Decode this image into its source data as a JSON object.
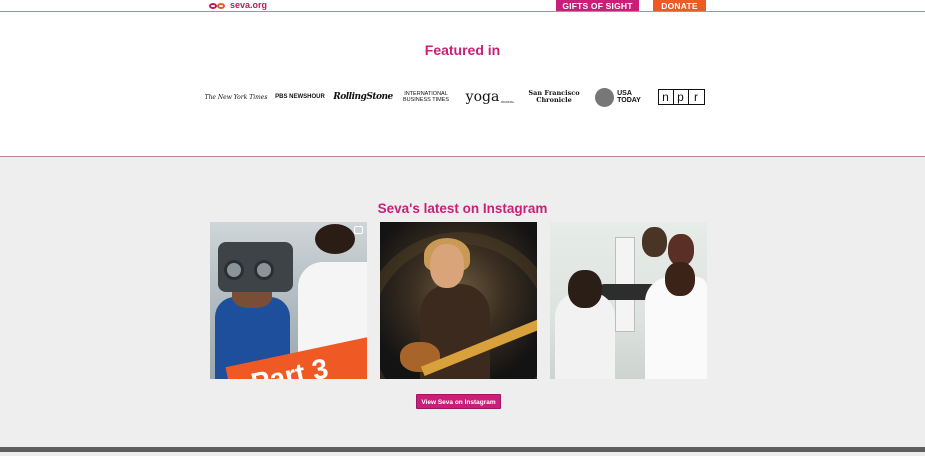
{
  "header": {
    "logo_text": "seva.org",
    "gifts_label": "GIFTS OF SIGHT",
    "donate_label": "DONATE"
  },
  "featured": {
    "title": "Featured in",
    "logos": [
      {
        "name": "The New York Times",
        "text": "The New York Times"
      },
      {
        "name": "PBS NewsHour",
        "text": "PBS NEWSHOUR"
      },
      {
        "name": "Rolling Stone",
        "text": "RollingStone"
      },
      {
        "name": "International Business Times",
        "line1": "INTERNATIONAL",
        "line2": "BUSINESS TIMES"
      },
      {
        "name": "Yoga Journal",
        "text": "yoga",
        "sub": "JOURNAL"
      },
      {
        "name": "San Francisco Chronicle",
        "line1": "San Francisco",
        "line2": "Chronicle"
      },
      {
        "name": "USA Today",
        "line1": "USA",
        "line2": "TODAY"
      },
      {
        "name": "NPR",
        "letters": [
          "n",
          "p",
          "r"
        ]
      }
    ]
  },
  "instagram": {
    "title": "Seva's latest on Instagram",
    "tile1_banner": "Part 3",
    "button_label": "View Seva on Instagram"
  },
  "colors": {
    "brand_magenta": "#c91f78",
    "donate_orange": "#ee5a24",
    "section_bg": "#eeeeee"
  }
}
